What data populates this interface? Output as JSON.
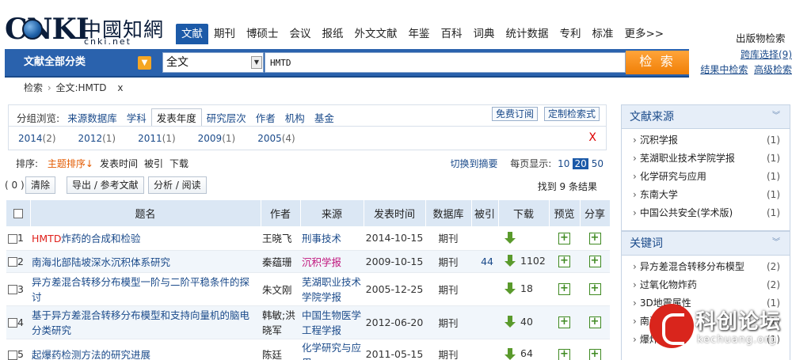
{
  "logo": {
    "main": "CNKI",
    "cn": "中國知網",
    "url": "cnki.net"
  },
  "nav": {
    "items": [
      "文献",
      "期刊",
      "博硕士",
      "会议",
      "报纸",
      "外文文献",
      "年鉴",
      "百科",
      "词典",
      "统计数据",
      "专利",
      "标准",
      "更多>>"
    ],
    "active_index": 0,
    "publisher": "出版物检索"
  },
  "search": {
    "category_label": "文献全部分类",
    "field": "全文",
    "query": "HMTD",
    "button": "检 索",
    "links": [
      "跨库选择(9)",
      "结果中检索",
      "高级检索"
    ]
  },
  "breadcrumb": {
    "home": "检索",
    "current": "全文:HMTD",
    "close": "x"
  },
  "group": {
    "label": "分组浏览:",
    "tabs": [
      "来源数据库",
      "学科",
      "发表年度",
      "研究层次",
      "作者",
      "机构",
      "基金"
    ],
    "active_tab": 2,
    "actions": [
      "免费订阅",
      "定制检索式"
    ],
    "years": [
      {
        "year": "2014",
        "count": "(2)"
      },
      {
        "year": "2012",
        "count": "(1)"
      },
      {
        "year": "2011",
        "count": "(1)"
      },
      {
        "year": "2009",
        "count": "(1)"
      },
      {
        "year": "2005",
        "count": "(4)"
      }
    ],
    "close": "X"
  },
  "sort": {
    "label": "排序:",
    "options": [
      "主题排序↓",
      "发表时间",
      "被引",
      "下载"
    ],
    "active_index": 0,
    "switch_abstract": "切换到摘要",
    "per_page_label": "每页显示:",
    "per_page": [
      "10",
      "20",
      "50"
    ],
    "per_page_active": 1
  },
  "actions": {
    "selected": "( 0 )",
    "clear": "清除",
    "export": "导出 / 参考文献",
    "analyze": "分析 / 阅读",
    "result_count": "找到 9 条结果"
  },
  "table": {
    "headers": [
      "题名",
      "作者",
      "来源",
      "发表时间",
      "数据库",
      "被引",
      "下载",
      "预览",
      "分享"
    ],
    "rows": [
      {
        "n": "1",
        "title_hl": "HMTD",
        "title": "炸药的合成和检验",
        "author": "王晓飞",
        "source": "刑事技术",
        "date": "2014-10-15",
        "db": "期刊",
        "cited": "",
        "downloads": "",
        "pink": false
      },
      {
        "n": "2",
        "title_hl": "",
        "title": "南海北部陆坡深水沉积体系研究",
        "author": "秦蕴珊",
        "source": "沉积学报",
        "date": "2009-10-15",
        "db": "期刊",
        "cited": "44",
        "downloads": "1102",
        "pink": true
      },
      {
        "n": "3",
        "title_hl": "",
        "title": "异方差混合转移分布模型一阶与二阶平稳条件的探讨",
        "author": "朱文刚",
        "source": "芜湖职业技术学院学报",
        "date": "2005-12-25",
        "db": "期刊",
        "cited": "",
        "downloads": "18",
        "pink": false
      },
      {
        "n": "4",
        "title_hl": "",
        "title": "基于异方差混合转移分布模型和支持向量机的脑电分类研究",
        "author": "韩敏;洪晓军",
        "source": "中国生物医学工程学报",
        "date": "2012-06-20",
        "db": "期刊",
        "cited": "",
        "downloads": "40",
        "pink": false
      },
      {
        "n": "5",
        "title_hl": "",
        "title": "起爆药检测方法的研究进展",
        "author": "陈廷",
        "source": "化学研究与应用",
        "date": "2011-05-15",
        "db": "期刊",
        "cited": "",
        "downloads": "64",
        "pink": false
      }
    ]
  },
  "sidebar": {
    "source": {
      "title": "文献来源",
      "items": [
        {
          "name": "沉积学报",
          "count": "(1)"
        },
        {
          "name": "芜湖职业技术学院学报",
          "count": "(1)"
        },
        {
          "name": "化学研究与应用",
          "count": "(1)"
        },
        {
          "name": "东南大学",
          "count": "(1)"
        },
        {
          "name": "中国公共安全(学术版)",
          "count": "(1)"
        }
      ]
    },
    "keywords": {
      "title": "关键词",
      "items": [
        {
          "name": "异方差混合转移分布模型",
          "count": "(2)"
        },
        {
          "name": "过氧化物炸药",
          "count": "(2)"
        },
        {
          "name": "3D地震属性",
          "count": "(1)"
        },
        {
          "name": "南海",
          "count": "(1)"
        },
        {
          "name": "爆炸残留物",
          "count": "(1)"
        }
      ]
    }
  },
  "watermark": {
    "text": "科创论坛",
    "url": "kechuang.org"
  }
}
